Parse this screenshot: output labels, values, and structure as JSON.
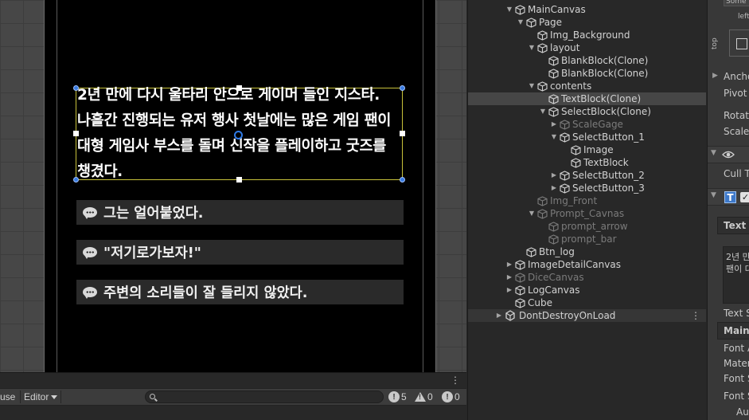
{
  "scene": {
    "text_block": "2년 만에 다시 울타리 안으로 게이머 들인 지스타. 나흘간 진행되는 유저 행사 첫날에는 많은 게임 팬이 대형 게임사 부스를 돌며 신작을 플레이하고 굿즈를 챙겼다.",
    "choices": [
      {
        "text": "그는 얼어붙었다."
      },
      {
        "text": "\"저기로가보자!\""
      },
      {
        "text": "주변의 소리들이 잘 들리지 않았다."
      }
    ]
  },
  "console": {
    "menu_icon": "⋮",
    "left_fragment": "use",
    "editor_label": "Editor",
    "search_placeholder": "",
    "info_count": "5",
    "warn_count": "0",
    "error_count": "0"
  },
  "hierarchy": {
    "items": [
      {
        "label": "MainCanvas",
        "depth": 1,
        "arrow": "down",
        "dim": false
      },
      {
        "label": "Page",
        "depth": 2,
        "arrow": "down",
        "dim": false
      },
      {
        "label": "Img_Background",
        "depth": 3,
        "arrow": "none",
        "dim": false
      },
      {
        "label": "layout",
        "depth": 3,
        "arrow": "down",
        "dim": false
      },
      {
        "label": "BlankBlock(Clone)",
        "depth": 4,
        "arrow": "none",
        "dim": false
      },
      {
        "label": "BlankBlock(Clone)",
        "depth": 4,
        "arrow": "none",
        "dim": false
      },
      {
        "label": "contents",
        "depth": 3,
        "arrow": "down",
        "dim": false
      },
      {
        "label": "TextBlock(Clone)",
        "depth": 4,
        "arrow": "none",
        "dim": false,
        "selected": true
      },
      {
        "label": "SelectBlock(Clone)",
        "depth": 4,
        "arrow": "down",
        "dim": false
      },
      {
        "label": "ScaleGage",
        "depth": 5,
        "arrow": "right",
        "dim": true
      },
      {
        "label": "SelectButton_1",
        "depth": 5,
        "arrow": "down",
        "dim": false
      },
      {
        "label": "Image",
        "depth": 6,
        "arrow": "none",
        "dim": false
      },
      {
        "label": "TextBlock",
        "depth": 6,
        "arrow": "none",
        "dim": false
      },
      {
        "label": "SelectButton_2",
        "depth": 5,
        "arrow": "right",
        "dim": false
      },
      {
        "label": "SelectButton_3",
        "depth": 5,
        "arrow": "right",
        "dim": false
      },
      {
        "label": "Img_Front",
        "depth": 3,
        "arrow": "none",
        "dim": true
      },
      {
        "label": "Prompt_Cavnas",
        "depth": 3,
        "arrow": "down",
        "dim": true
      },
      {
        "label": "prompt_arrow",
        "depth": 4,
        "arrow": "none",
        "dim": true
      },
      {
        "label": "prompt_bar",
        "depth": 4,
        "arrow": "none",
        "dim": true
      },
      {
        "label": "Btn_log",
        "depth": 2,
        "arrow": "none",
        "dim": false
      },
      {
        "label": "ImageDetailCanvas",
        "depth": 1,
        "arrow": "right",
        "dim": false
      },
      {
        "label": "DiceCanvas",
        "depth": 1,
        "arrow": "right",
        "dim": true
      },
      {
        "label": "LogCanvas",
        "depth": 1,
        "arrow": "right",
        "dim": false
      },
      {
        "label": "Cube",
        "depth": 1,
        "arrow": "none",
        "dim": false
      }
    ],
    "ddol_label": "DontDestroyOnLoad",
    "ddol_menu": "⋮"
  },
  "inspector": {
    "top_fragment": "Some",
    "left_label": "left",
    "top_label": "top",
    "anchors_label": "Ancho",
    "pivot_label": "Pivot",
    "rotation_label": "Rotati",
    "scale_label": "Scale",
    "cull_label": "Cull T",
    "text_input_header": "Text I",
    "text_preview_line1": "2년 만",
    "text_preview_line2": "팬이 대",
    "text_style_label": "Text S",
    "main_settings_label": "Main S",
    "font_asset_label": "Font A",
    "material_label": "Mater",
    "font_style_label": "Font S",
    "font_size_label": "Font S",
    "auto_size_label": "Au"
  },
  "colors": {
    "selection_outline": "#c8c23a",
    "handle_blue": "#3a7be0",
    "selected_row": "#464646"
  }
}
